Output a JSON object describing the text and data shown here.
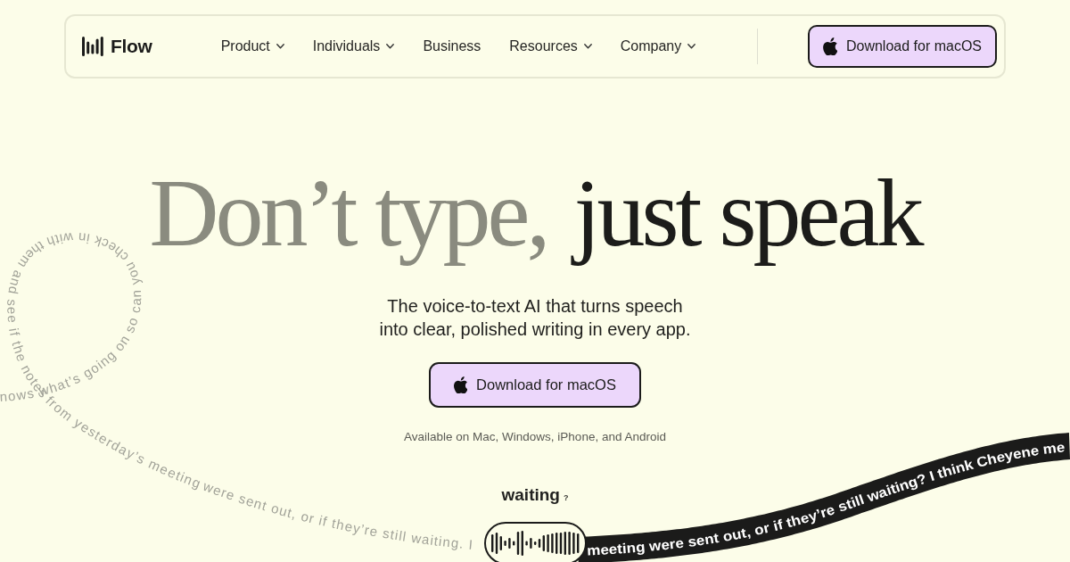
{
  "nav": {
    "logo": "Flow",
    "items": [
      {
        "label": "Product",
        "dropdown": true
      },
      {
        "label": "Individuals",
        "dropdown": true
      },
      {
        "label": "Business",
        "dropdown": false
      },
      {
        "label": "Resources",
        "dropdown": true
      },
      {
        "label": "Company",
        "dropdown": true
      }
    ],
    "cta": "Download for macOS"
  },
  "hero": {
    "headline": [
      {
        "text": "Don’t type,",
        "color": "#8a8b7f"
      },
      {
        "text": "just speak",
        "color": "#1c1c1a"
      }
    ],
    "subtitle": "The voice-to-text AI that turns speech into clear, polished writing in every app.",
    "cta": "Download for macOS",
    "availability": "Available on Mac, Windows, iPhone, and Android"
  },
  "dictation": {
    "word": "waiting",
    "mark": "?",
    "trail_text": [
      "nows what’s going on so can you check in with them and see if the notes",
      "from yesterday’s meeting",
      "were sent out, or if they’re still waiting. I"
    ],
    "ribbon_text": [
      "meeting were sent out,",
      "or if they’re still waiting?",
      "I think Cheyene me"
    ]
  }
}
